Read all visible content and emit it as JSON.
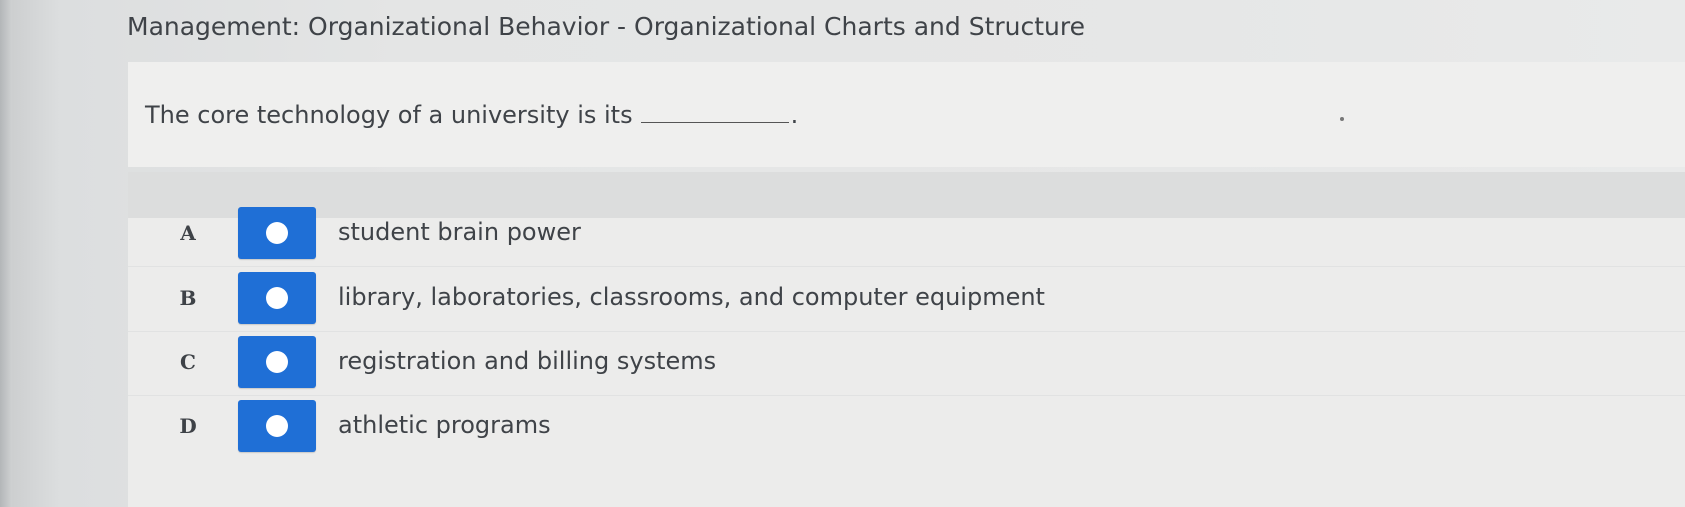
{
  "header": {
    "title": "Management: Organizational Behavior - Organizational Charts and Structure"
  },
  "question": {
    "prompt": "The core technology of a university is its",
    "end_punctuation": "."
  },
  "answers": [
    {
      "letter": "A",
      "text": "student brain power"
    },
    {
      "letter": "B",
      "text": "library, laboratories, classrooms, and computer equipment"
    },
    {
      "letter": "C",
      "text": "registration and billing systems"
    },
    {
      "letter": "D",
      "text": "athletic programs"
    }
  ],
  "colors": {
    "radio_button": "#1f6fd6",
    "radio_dot": "#ffffff"
  },
  "icons": {
    "radio": "radio-dot-icon"
  }
}
